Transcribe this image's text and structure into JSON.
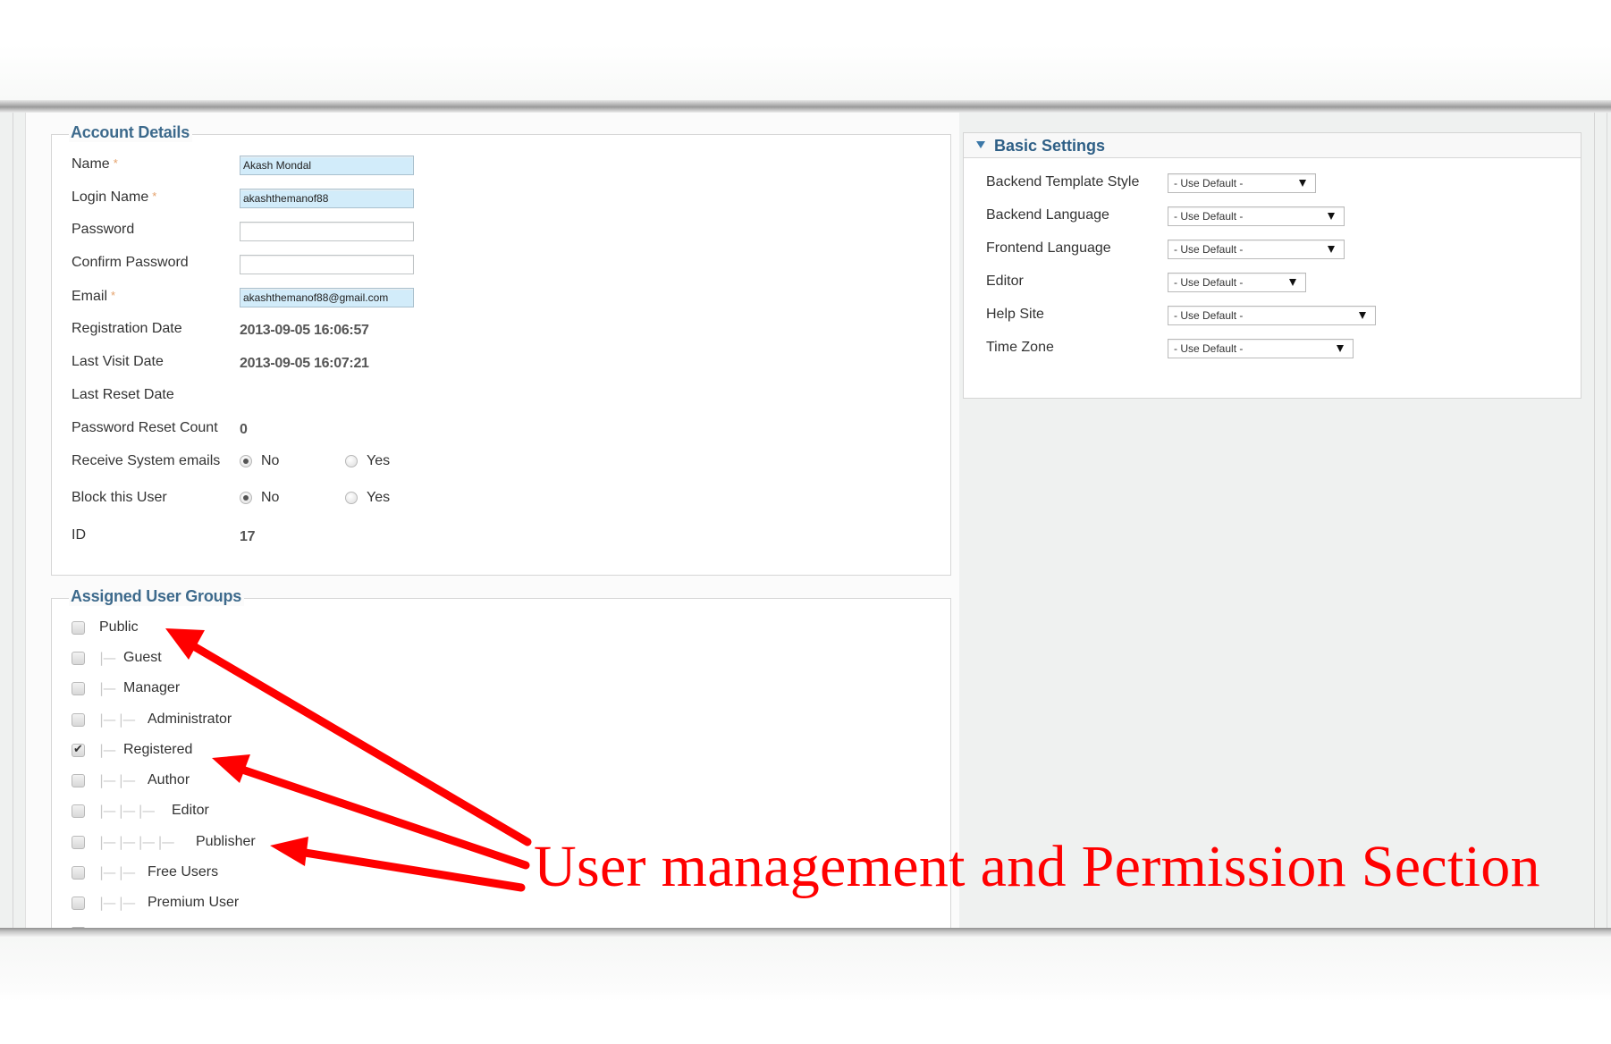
{
  "account_details": {
    "legend": "Account Details",
    "fields": {
      "name": {
        "label": "Name",
        "required": true,
        "value": "Akash Mondal"
      },
      "login_name": {
        "label": "Login Name",
        "required": true,
        "value": "akashthemanof88"
      },
      "password": {
        "label": "Password",
        "required": false,
        "value": ""
      },
      "confirm_password": {
        "label": "Confirm Password",
        "required": false,
        "value": ""
      },
      "email": {
        "label": "Email",
        "required": true,
        "value": "akashthemanof88@gmail.com"
      }
    },
    "required_marker": "*",
    "registration_date": {
      "label": "Registration Date",
      "value": "2013-09-05 16:06:57"
    },
    "last_visit_date": {
      "label": "Last Visit Date",
      "value": "2013-09-05 16:07:21"
    },
    "last_reset_date": {
      "label": "Last Reset Date",
      "value": ""
    },
    "password_reset_count": {
      "label": "Password Reset Count",
      "value": "0"
    },
    "receive_system_emails": {
      "label": "Receive System emails",
      "options": [
        "No",
        "Yes"
      ],
      "selected": "No"
    },
    "block_this_user": {
      "label": "Block this User",
      "options": [
        "No",
        "Yes"
      ],
      "selected": "No"
    },
    "id": {
      "label": "ID",
      "value": "17"
    }
  },
  "user_groups": {
    "legend": "Assigned User Groups",
    "items": [
      {
        "label": "Public",
        "level": 0,
        "checked": false,
        "branch": ""
      },
      {
        "label": "Guest",
        "level": 1,
        "checked": false,
        "branch": "|—"
      },
      {
        "label": "Manager",
        "level": 1,
        "checked": false,
        "branch": "|—"
      },
      {
        "label": "Administrator",
        "level": 2,
        "checked": false,
        "branch": "|— |—"
      },
      {
        "label": "Registered",
        "level": 1,
        "checked": true,
        "branch": "|—"
      },
      {
        "label": "Author",
        "level": 2,
        "checked": false,
        "branch": "|— |—"
      },
      {
        "label": "Editor",
        "level": 3,
        "checked": false,
        "branch": "|— |— |—"
      },
      {
        "label": "Publisher",
        "level": 4,
        "checked": false,
        "branch": "|— |— |— |—"
      },
      {
        "label": "Free Users",
        "level": 2,
        "checked": false,
        "branch": "|— |—"
      },
      {
        "label": "Premium User",
        "level": 2,
        "checked": false,
        "branch": "|— |—"
      }
    ]
  },
  "basic_settings": {
    "title": "Basic Settings",
    "caret_icon": "caret-down-icon",
    "settings": [
      {
        "label": "Backend Template Style",
        "value": "- Use Default -"
      },
      {
        "label": "Backend Language",
        "value": "- Use Default -"
      },
      {
        "label": "Frontend Language",
        "value": "- Use Default -"
      },
      {
        "label": "Editor",
        "value": "- Use Default -"
      },
      {
        "label": "Help Site",
        "value": "- Use Default -"
      },
      {
        "label": "Time Zone",
        "value": "- Use Default -"
      }
    ]
  },
  "annotation": {
    "text": "User management and Permission Section",
    "color": "#ff0000",
    "arrow_targets": [
      "Public",
      "Registered",
      "Publisher"
    ]
  },
  "colors": {
    "legend": "#3d6a8c",
    "filled_input": "#d2ecfa",
    "annotation": "#ff0000"
  }
}
